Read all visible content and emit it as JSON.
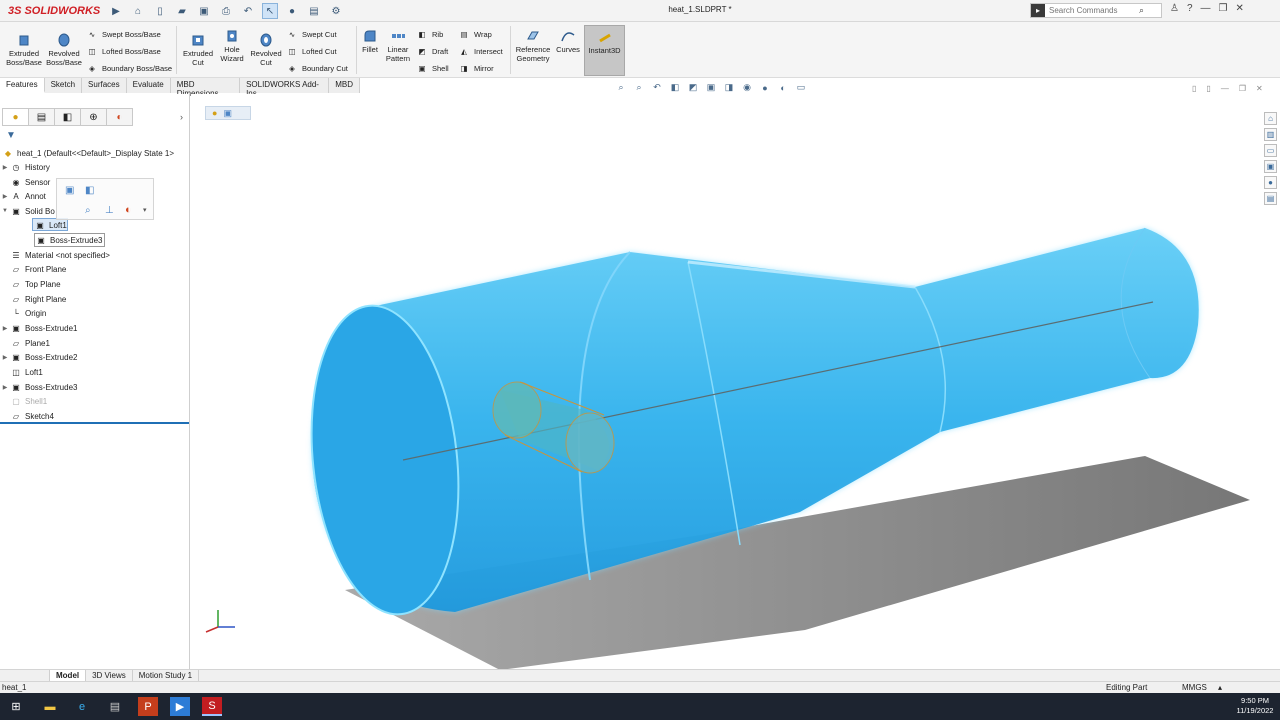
{
  "app": {
    "brand": "SOLIDWORKS",
    "document_title": "heat_1.SLDPRT *"
  },
  "search": {
    "placeholder": "Search Commands"
  },
  "ribbon": {
    "extruded_boss": "Extruded Boss/Base",
    "revolved_boss": "Revolved Boss/Base",
    "swept_boss": "Swept Boss/Base",
    "lofted_boss": "Lofted Boss/Base",
    "boundary_boss": "Boundary Boss/Base",
    "extruded_cut": "Extruded Cut",
    "hole_wizard": "Hole Wizard",
    "revolved_cut": "Revolved Cut",
    "swept_cut": "Swept Cut",
    "lofted_cut": "Lofted Cut",
    "boundary_cut": "Boundary Cut",
    "fillet": "Fillet",
    "linear_pattern": "Linear Pattern",
    "rib": "Rib",
    "draft": "Draft",
    "shell": "Shell",
    "wrap": "Wrap",
    "intersect": "Intersect",
    "mirror": "Mirror",
    "reference_geometry": "Reference Geometry",
    "curves": "Curves",
    "instant3d": "Instant3D"
  },
  "command_tabs": [
    "Features",
    "Sketch",
    "Surfaces",
    "Evaluate",
    "MBD Dimensions",
    "SOLIDWORKS Add-Ins",
    "MBD"
  ],
  "tree": {
    "root": "heat_1  (Default<<Default>_Display State 1>",
    "history": "History",
    "sensors": "Sensor",
    "annotations": "Annot",
    "solid_bodies": "Solid Bo",
    "popup_loft": "Loft1",
    "popup_boss": "Boss-Extrude3",
    "material": "Material <not specified>",
    "front_plane": "Front Plane",
    "top_plane": "Top Plane",
    "right_plane": "Right Plane",
    "origin": "Origin",
    "boss_extrude1": "Boss-Extrude1",
    "plane1": "Plane1",
    "boss_extrude2": "Boss-Extrude2",
    "loft1": "Loft1",
    "boss_extrude3": "Boss-Extrude3",
    "shell1": "Shell1",
    "sketch4": "Sketch4"
  },
  "bottom_tabs": [
    "Model",
    "3D Views",
    "Motion Study 1"
  ],
  "status": {
    "file": "heat_1",
    "mode": "Editing Part",
    "units": "MMGS"
  },
  "clock": {
    "time": "9:50 PM",
    "date": "11/19/2022"
  },
  "colors": {
    "part": "#2fb0ec",
    "accent": "#d01f25",
    "selection": "#dbe9f8",
    "taskbar": "#1d2430"
  }
}
